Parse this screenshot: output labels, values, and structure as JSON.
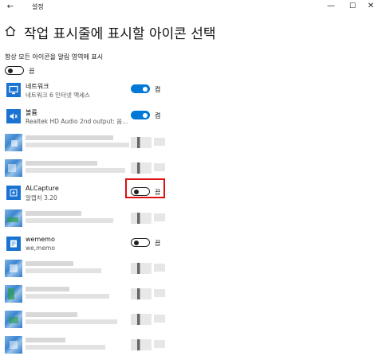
{
  "titlebar": {
    "back": "←",
    "title": "설정",
    "minimize": "—",
    "maximize": "☐",
    "close": "✕"
  },
  "header": {
    "title": "작업 표시줄에 표시할 아이콘 선택"
  },
  "always_show": {
    "label": "항상 모든 아이콘을 알림 영역에 표시",
    "state": "off",
    "state_label": "끔"
  },
  "apps": [
    {
      "name": "네트워크",
      "subtitle": "네트워크 6 인터넷 액세스",
      "state": "on",
      "state_label": "켬",
      "icon": "network-icon"
    },
    {
      "name": "볼륨",
      "subtitle": "Realtek HD Audio 2nd output: 음...",
      "state": "on",
      "state_label": "켬",
      "icon": "volume-icon"
    },
    {
      "name": "ALCapture",
      "subtitle": "알캡처 3.20",
      "state": "off",
      "state_label": "끔",
      "icon": "alcapture-icon"
    },
    {
      "name": "wememo",
      "subtitle": "we,memo",
      "state": "off",
      "state_label": "끔",
      "icon": "wememo-icon"
    }
  ],
  "colors": {
    "accent": "#0078d7",
    "highlight": "#dd1111"
  }
}
